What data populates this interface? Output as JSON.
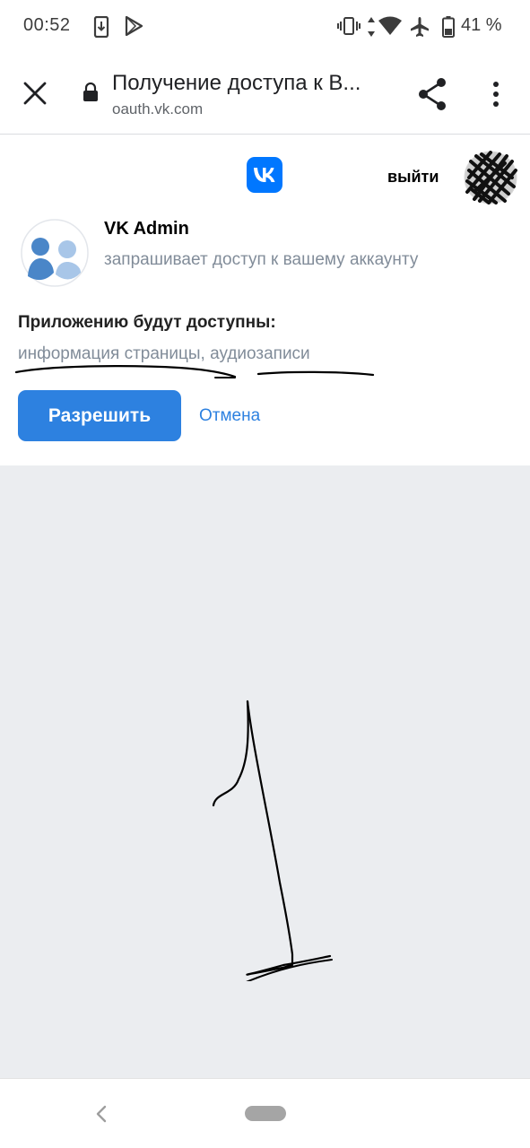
{
  "status_bar": {
    "time": "00:52",
    "battery_percent": "41 %",
    "icons": [
      "download-icon",
      "play-store-icon",
      "vibrate-icon",
      "data-arrows-icon",
      "wifi-icon",
      "airplane-icon",
      "battery-icon"
    ]
  },
  "browser": {
    "page_title": "Получение доступа к В...",
    "domain": "oauth.vk.com",
    "icons": [
      "close-icon",
      "lock-icon",
      "share-icon",
      "more-vert-icon"
    ]
  },
  "header": {
    "logo_icon": "vk-logo-icon",
    "logout_label": "выйти",
    "avatar_icon": "user-avatar"
  },
  "app": {
    "name": "VK Admin",
    "description": "запрашивает доступ к вашему аккаунту",
    "icon": "app-users-icon"
  },
  "permissions": {
    "title": "Приложению будут доступны:",
    "list": "информация страницы, аудиозаписи"
  },
  "actions": {
    "allow_label": "Разрешить",
    "cancel_label": "Отмена"
  },
  "annotation": {
    "drawn_number": "1"
  },
  "colors": {
    "vk_blue": "#2d81e0",
    "vk_logo": "#0077ff",
    "muted_text": "#818c99",
    "gray_area": "#ebedf0"
  }
}
